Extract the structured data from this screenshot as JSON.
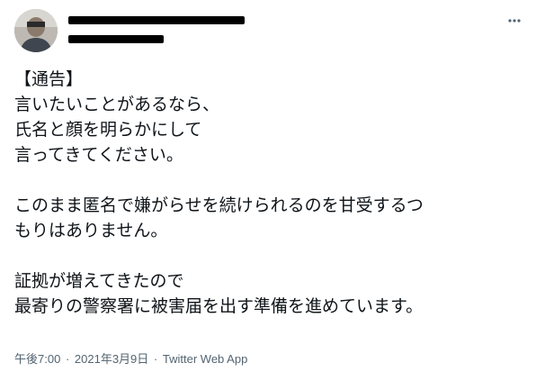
{
  "tweet": {
    "author": {
      "display_name": "",
      "handle": "",
      "avatar": "profile-photo-icon"
    },
    "more_icon": "more-horizontal-icon",
    "text_lines": [
      "【通告】",
      "言いたいことがあるなら、",
      "氏名と顔を明らかにして",
      "言ってきてください。",
      "",
      "このまま匿名で嫌がらせを続けられるのを甘受するつ",
      "もりはありません。",
      "",
      "証拠が増えてきたので",
      "最寄りの警察署に被害届を出す準備を進めています。"
    ],
    "meta": {
      "time": "午後7:00",
      "separator": "·",
      "date": "2021年3月9日",
      "source": "Twitter Web App"
    }
  },
  "colors": {
    "text_primary": "#0f1419",
    "text_secondary": "#536471",
    "background": "#ffffff",
    "redaction": "#000000"
  }
}
